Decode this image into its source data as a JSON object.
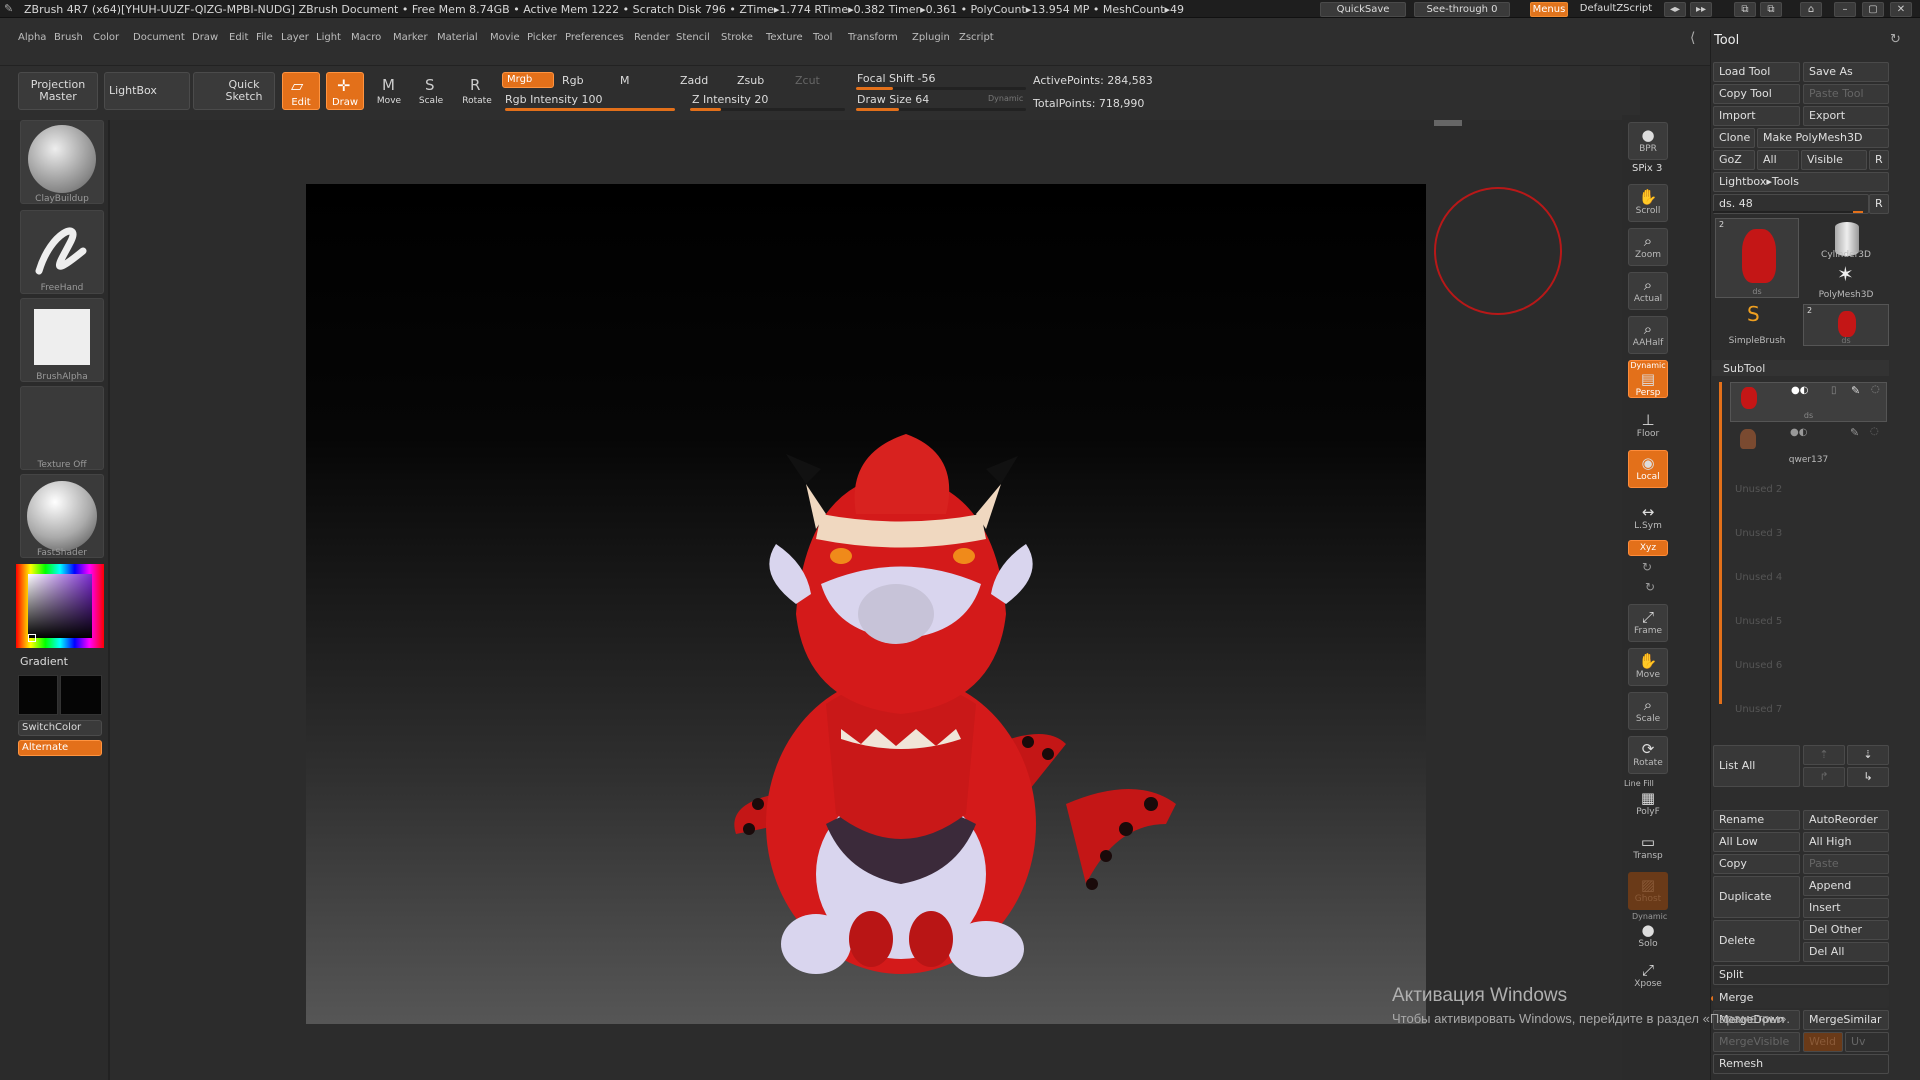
{
  "titlebar": {
    "text": "ZBrush 4R7 (x64)[YHUH-UUZF-QIZG-MPBI-NUDG]   ZBrush Document     • Free Mem 8.74GB • Active Mem 1222 • Scratch Disk 796 •  ZTime▸1.774 RTime▸0.382 Timer▸0.361 • PolyCount▸13.954 MP  • MeshCount▸49",
    "quicksave": "QuickSave",
    "see_through": "See-through  0",
    "menus": "Menus",
    "zscript": "DefaultZScript"
  },
  "menubar": [
    "Alpha",
    "Brush",
    "Color",
    "Document",
    "Draw",
    "Edit",
    "File",
    "Layer",
    "Light",
    "Macro",
    "Marker",
    "Material",
    "Movie",
    "Picker",
    "Preferences",
    "Render",
    "Stencil",
    "Stroke",
    "Texture",
    "Tool",
    "Transform",
    "Zplugin",
    "Zscript"
  ],
  "toolbar": {
    "projection_master": "Projection Master",
    "lightbox": "LightBox",
    "quick_sketch": "Quick Sketch",
    "edit": "Edit",
    "draw": "Draw",
    "move": "Move",
    "scale": "Scale",
    "rotate": "Rotate",
    "mrgb": "Mrgb",
    "rgb": "Rgb",
    "m": "M",
    "zadd": "Zadd",
    "zsub": "Zsub",
    "zcut": "Zcut",
    "rgb_intensity": "Rgb Intensity 100",
    "z_intensity": "Z Intensity 20",
    "focal_shift": "Focal Shift -56",
    "draw_size": "Draw Size 64",
    "dynamic": "Dynamic",
    "active_points": "ActivePoints: 284,583",
    "total_points": "TotalPoints: 718,990"
  },
  "left": {
    "brush1": "ClayBuildup",
    "stroke": "FreeHand",
    "alpha": "BrushAlpha",
    "texture": "Texture Off",
    "material": "FastShader",
    "gradient": "Gradient",
    "switchcolor": "SwitchColor",
    "alternate": "Alternate"
  },
  "shelf": {
    "bpr": "BPR",
    "spix": "SPix 3",
    "scroll": "Scroll",
    "zoom": "Zoom",
    "actual": "Actual",
    "aahalf": "AAHalf",
    "dynamic": "Dynamic",
    "persp": "Persp",
    "floor": "Floor",
    "local": "Local",
    "lsym": "L.Sym",
    "xyz": "Xyz",
    "frame": "Frame",
    "move": "Move",
    "scale": "Scale",
    "rotate": "Rotate",
    "linefill": "Line Fill",
    "polyf": "PolyF",
    "transp": "Transp",
    "ghost": "Ghost",
    "dynamic2": "Dynamic",
    "solo": "Solo",
    "xpose": "Xpose"
  },
  "tool": {
    "title": "Tool",
    "load_tool": "Load Tool",
    "save_as": "Save As",
    "copy_tool": "Copy Tool",
    "paste_tool": "Paste Tool",
    "import": "Import",
    "export": "Export",
    "clone": "Clone",
    "make_polymesh": "Make PolyMesh3D",
    "goz": "GoZ",
    "all": "All",
    "visible": "Visible",
    "r": "R",
    "lightbox_tools": "Lightbox▸Tools",
    "ds_slider": "ds. 48",
    "thumbs": [
      {
        "label": "ds",
        "count": "2"
      },
      {
        "label": "Cylinder3D",
        "count": ""
      },
      {
        "label": "PolyMesh3D",
        "count": ""
      },
      {
        "label": "SimpleBrush",
        "count": ""
      },
      {
        "label": "ds",
        "count": "2"
      }
    ],
    "subtool_title": "SubTool",
    "subtools": [
      "ds",
      "qwer137"
    ],
    "unused": [
      "Unused 2",
      "Unused 3",
      "Unused 4",
      "Unused 5",
      "Unused 6",
      "Unused 7"
    ],
    "list_all": "List All",
    "rename": "Rename",
    "autoreorder": "AutoReorder",
    "all_low": "All Low",
    "all_high": "All High",
    "copy": "Copy",
    "paste": "Paste",
    "append": "Append",
    "duplicate": "Duplicate",
    "insert": "Insert",
    "del_other": "Del Other",
    "delete": "Delete",
    "del_all": "Del All",
    "split": "Split",
    "merge": "Merge",
    "merge_down": "MergeDown",
    "merge_similar": "MergeSimilar",
    "merge_visible": "MergeVisible",
    "weld": "Weld",
    "uv": "Uv",
    "remesh": "Remesh"
  },
  "watermark": {
    "title": "Активация Windows",
    "subtitle": "Чтобы активировать Windows, перейдите в раздел «Параметры»."
  },
  "colors": {
    "accent": "#e3701a",
    "model_red": "#d41a1a",
    "cursor_ring": "#c01818"
  }
}
